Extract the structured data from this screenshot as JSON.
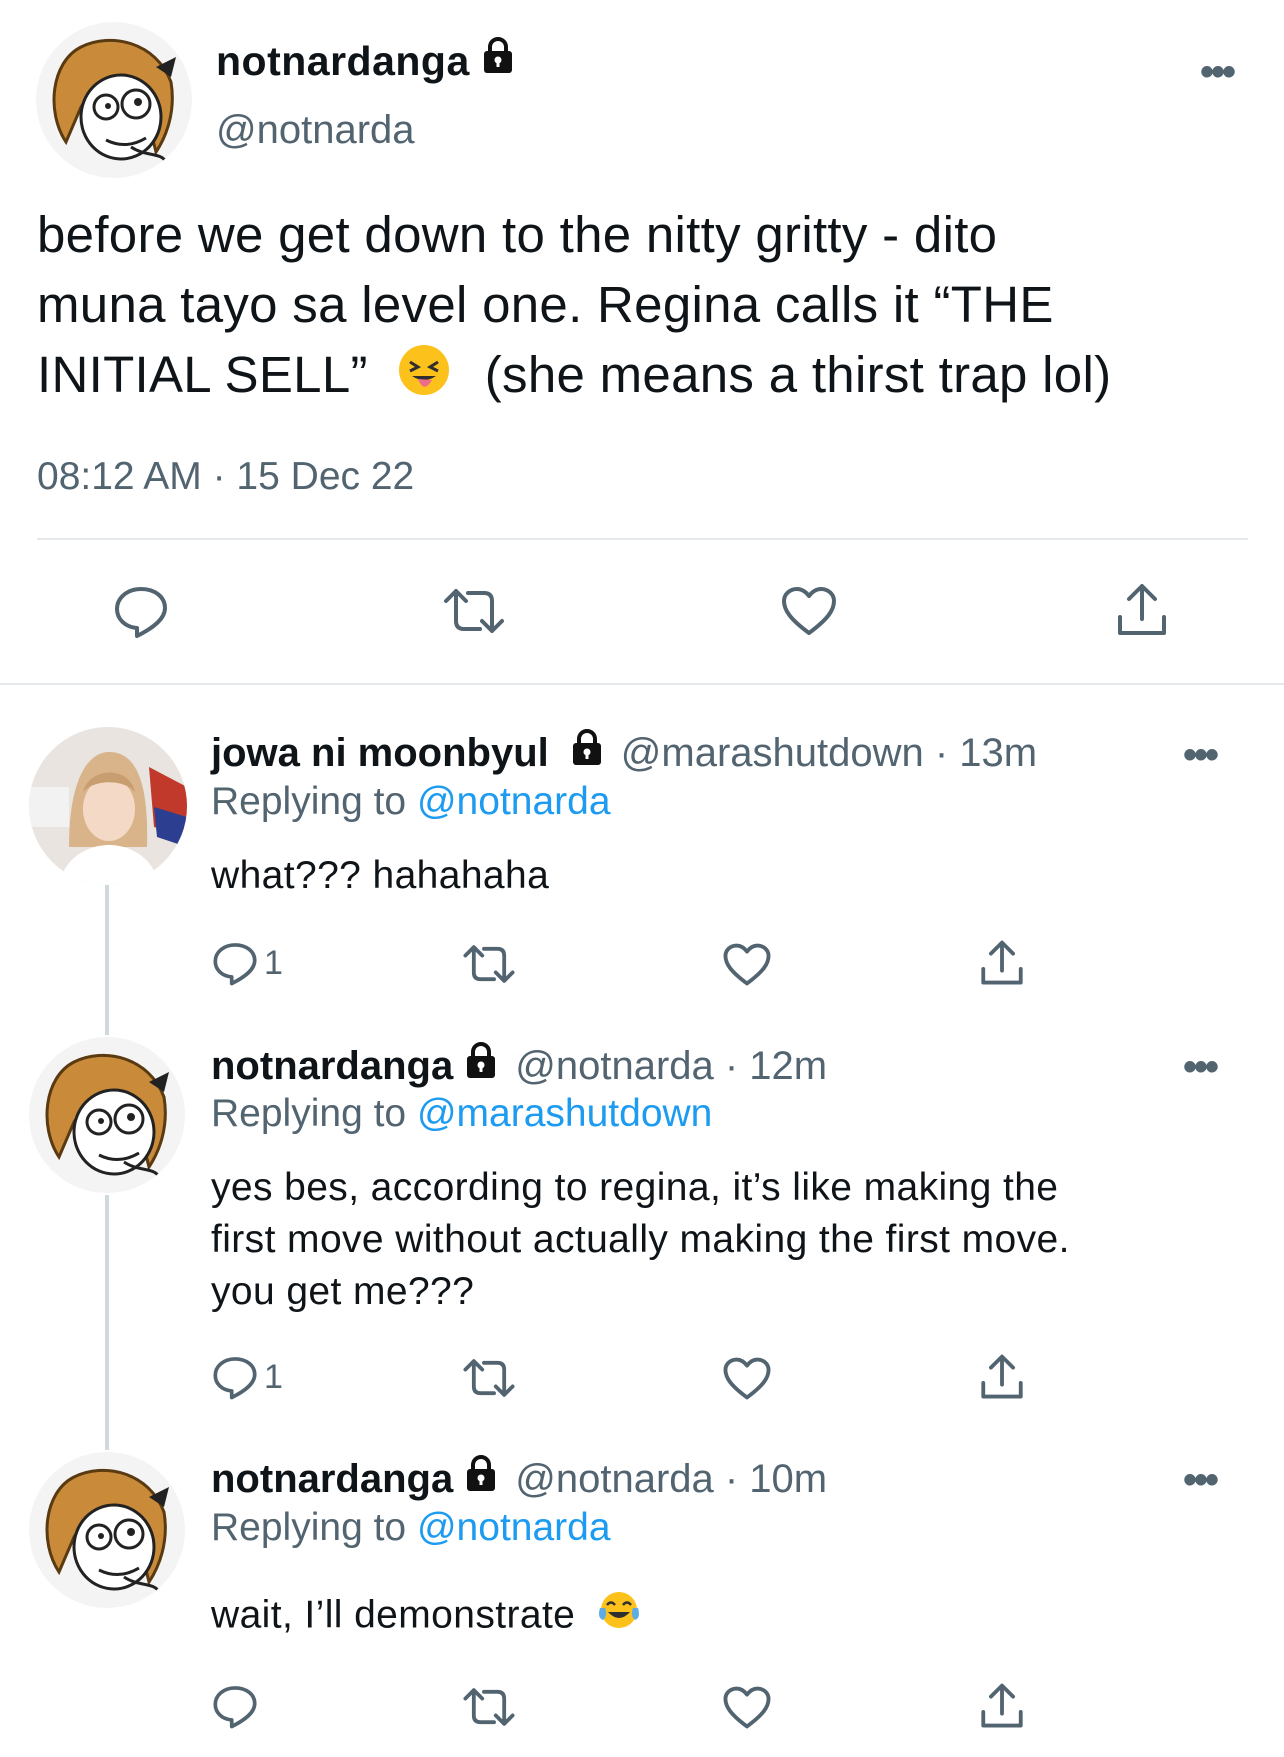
{
  "main_tweet": {
    "display_name": "notnardanga",
    "handle": "@notnarda",
    "text_line1": "before we get down to the nitty gritty - dito",
    "text_line2": "muna tayo sa level one. Regina calls it “THE",
    "text_line3a": "INITIAL SELL”",
    "text_line3b": "(she means a thirst trap lol)",
    "timestamp": "08:12 AM · 15 Dec 22",
    "icons": [
      "reply-icon",
      "retweet-icon",
      "like-icon",
      "share-icon"
    ]
  },
  "replies": [
    {
      "display_name": "jowa ni moonbyul",
      "handle_time": "@marashutdown · 13m",
      "replying_prefix": "Replying to",
      "replying_to": "@notnarda",
      "text_lines": [
        "what??? hahahaha"
      ],
      "reply_count": "1"
    },
    {
      "display_name": "notnardanga",
      "handle_time": "@notnarda · 12m",
      "replying_prefix": "Replying to",
      "replying_to": "@marashutdown",
      "text_lines": [
        "yes bes, according to regina, it’s like making the",
        "first move without actually making the first move.",
        "you get me???"
      ],
      "reply_count": "1"
    },
    {
      "display_name": "notnardanga",
      "handle_time": "@notnarda · 10m",
      "replying_prefix": "Replying to",
      "replying_to": "@notnarda",
      "text_lines": [
        "wait, I’ll demonstrate"
      ],
      "reply_count": ""
    }
  ],
  "more_label": "•••",
  "colors": {
    "accent": "#1d9bf0",
    "secondary_text": "#536471",
    "divider": "#e6e9ec"
  }
}
